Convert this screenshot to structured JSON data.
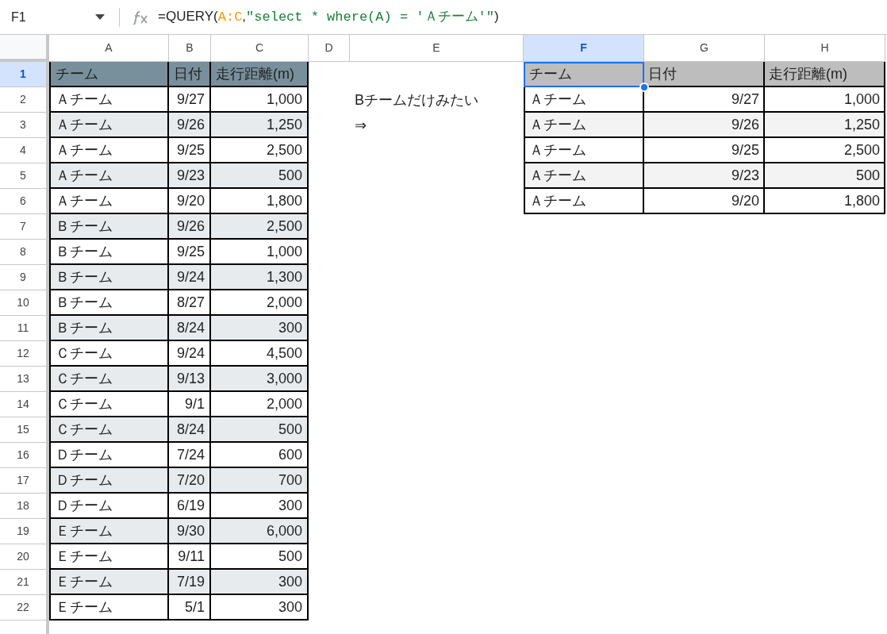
{
  "name_box": "F1",
  "formula": [
    {
      "kind": "function",
      "text": "=QUERY("
    },
    {
      "kind": "range",
      "text": "A:C"
    },
    {
      "kind": "plain",
      "text": ","
    },
    {
      "kind": "string",
      "text": "\"select * where(A) = 'Ａチーム'\""
    },
    {
      "kind": "function",
      "text": ")"
    }
  ],
  "column_headers": [
    {
      "label": "A",
      "selected": false
    },
    {
      "label": "B",
      "selected": false
    },
    {
      "label": "C",
      "selected": false
    },
    {
      "label": "D",
      "selected": false
    },
    {
      "label": "E",
      "selected": false
    },
    {
      "label": "F",
      "selected": true
    },
    {
      "label": "G",
      "selected": false
    },
    {
      "label": "H",
      "selected": false
    }
  ],
  "row_headers": [
    {
      "label": "1",
      "selected": true
    },
    {
      "label": "2",
      "selected": false
    },
    {
      "label": "3",
      "selected": false
    },
    {
      "label": "4",
      "selected": false
    },
    {
      "label": "5",
      "selected": false
    },
    {
      "label": "6",
      "selected": false
    },
    {
      "label": "7",
      "selected": false
    },
    {
      "label": "8",
      "selected": false
    },
    {
      "label": "9",
      "selected": false
    },
    {
      "label": "10",
      "selected": false
    },
    {
      "label": "11",
      "selected": false
    },
    {
      "label": "12",
      "selected": false
    },
    {
      "label": "13",
      "selected": false
    },
    {
      "label": "14",
      "selected": false
    },
    {
      "label": "15",
      "selected": false
    },
    {
      "label": "16",
      "selected": false
    },
    {
      "label": "17",
      "selected": false
    },
    {
      "label": "18",
      "selected": false
    },
    {
      "label": "19",
      "selected": false
    },
    {
      "label": "20",
      "selected": false
    },
    {
      "label": "21",
      "selected": false
    },
    {
      "label": "22",
      "selected": false
    }
  ],
  "source_table": {
    "columns": [
      "チーム",
      "日付",
      "走行距離(m)"
    ],
    "rows": [
      [
        "Ａチーム",
        "9/27",
        "1,000"
      ],
      [
        "Ａチーム",
        "9/26",
        "1,250"
      ],
      [
        "Ａチーム",
        "9/25",
        "2,500"
      ],
      [
        "Ａチーム",
        "9/23",
        "500"
      ],
      [
        "Ａチーム",
        "9/20",
        "1,800"
      ],
      [
        "Ｂチーム",
        "9/26",
        "2,500"
      ],
      [
        "Ｂチーム",
        "9/25",
        "1,000"
      ],
      [
        "Ｂチーム",
        "9/24",
        "1,300"
      ],
      [
        "Ｂチーム",
        "8/27",
        "2,000"
      ],
      [
        "Ｂチーム",
        "8/24",
        "300"
      ],
      [
        "Ｃチーム",
        "9/24",
        "4,500"
      ],
      [
        "Ｃチーム",
        "9/13",
        "3,000"
      ],
      [
        "Ｃチーム",
        "9/1",
        "2,000"
      ],
      [
        "Ｃチーム",
        "8/24",
        "500"
      ],
      [
        "Ｄチーム",
        "7/24",
        "600"
      ],
      [
        "Ｄチーム",
        "7/20",
        "700"
      ],
      [
        "Ｄチーム",
        "6/19",
        "300"
      ],
      [
        "Ｅチーム",
        "9/30",
        "6,000"
      ],
      [
        "Ｅチーム",
        "9/11",
        "500"
      ],
      [
        "Ｅチーム",
        "7/19",
        "300"
      ],
      [
        "Ｅチーム",
        "5/1",
        "300"
      ]
    ]
  },
  "notes": [
    "Bチームだけみたい",
    "⇒"
  ],
  "result_table": {
    "columns": [
      {
        "label": "チーム",
        "selected": true
      },
      {
        "label": "日付",
        "selected": false
      },
      {
        "label": "走行距離(m)",
        "selected": false
      }
    ],
    "rows": [
      [
        "Ａチーム",
        "9/27",
        "1,000"
      ],
      [
        "Ａチーム",
        "9/26",
        "1,250"
      ],
      [
        "Ａチーム",
        "9/25",
        "2,500"
      ],
      [
        "Ａチーム",
        "9/23",
        "500"
      ],
      [
        "Ａチーム",
        "9/20",
        "1,800"
      ]
    ]
  }
}
